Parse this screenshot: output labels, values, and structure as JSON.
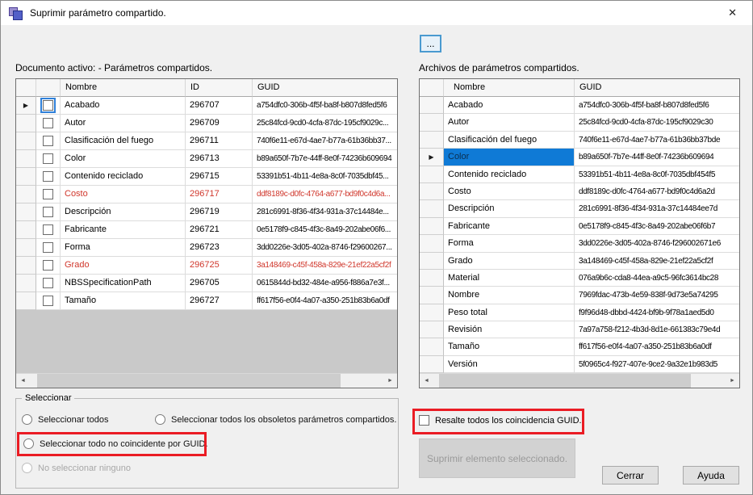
{
  "window": {
    "title": "Suprimir parámetro compartido.",
    "close_glyph": "✕"
  },
  "toolbar": {
    "browse_label": "..."
  },
  "icons": {
    "row_arrow": "▶",
    "scroll_left": "◄",
    "scroll_right": "►"
  },
  "colors": {
    "selection_bg": "#0f7ad6",
    "red_text": "#d0372c",
    "annotation": "#ea1c24",
    "focus_blue": "#2f80d9"
  },
  "left_panel": {
    "label": "Documento activo: - Parámetros compartidos.",
    "columns": [
      "Nombre",
      "ID",
      "GUID"
    ],
    "rows": [
      {
        "nombre": "Acabado",
        "id": "296707",
        "guid": "a754dfc0-306b-4f5f-ba8f-b807d8fed5f6",
        "red": false,
        "current": true,
        "checkbox_focused": true
      },
      {
        "nombre": "Autor",
        "id": "296709",
        "guid": "25c84fcd-9cd0-4cfa-87dc-195cf9029c...",
        "red": false,
        "current": false,
        "checkbox_focused": false
      },
      {
        "nombre": "Clasificación del fuego",
        "id": "296711",
        "guid": "740f6e11-e67d-4ae7-b77a-61b36bb37...",
        "red": false,
        "current": false,
        "checkbox_focused": false
      },
      {
        "nombre": "Color",
        "id": "296713",
        "guid": "b89a650f-7b7e-44ff-8e0f-74236b609694",
        "red": false,
        "current": false,
        "checkbox_focused": false
      },
      {
        "nombre": "Contenido reciclado",
        "id": "296715",
        "guid": "53391b51-4b11-4e8a-8c0f-7035dbf45...",
        "red": false,
        "current": false,
        "checkbox_focused": false
      },
      {
        "nombre": "Costo",
        "id": "296717",
        "guid": "ddf8189c-d0fc-4764-a677-bd9f0c4d6a...",
        "red": true,
        "current": false,
        "checkbox_focused": false
      },
      {
        "nombre": "Descripción",
        "id": "296719",
        "guid": "281c6991-8f36-4f34-931a-37c14484e...",
        "red": false,
        "current": false,
        "checkbox_focused": false
      },
      {
        "nombre": "Fabricante",
        "id": "296721",
        "guid": "0e5178f9-c845-4f3c-8a49-202abe06f6...",
        "red": false,
        "current": false,
        "checkbox_focused": false
      },
      {
        "nombre": "Forma",
        "id": "296723",
        "guid": "3dd0226e-3d05-402a-8746-f29600267...",
        "red": false,
        "current": false,
        "checkbox_focused": false
      },
      {
        "nombre": "Grado",
        "id": "296725",
        "guid": "3a148469-c45f-458a-829e-21ef22a5cf2f",
        "red": true,
        "current": false,
        "checkbox_focused": false
      },
      {
        "nombre": "NBSSpecificationPath",
        "id": "296705",
        "guid": "0615844d-bd32-484e-a956-f886a7e3f...",
        "red": false,
        "current": false,
        "checkbox_focused": false
      },
      {
        "nombre": "Tamaño",
        "id": "296727",
        "guid": "ff617f56-e0f4-4a07-a350-251b83b6a0df",
        "red": false,
        "current": false,
        "checkbox_focused": false
      }
    ]
  },
  "right_panel": {
    "label": "Archivos de parámetros compartidos.",
    "columns": [
      "Nombre",
      "GUID"
    ],
    "selected_index": 3,
    "rows": [
      {
        "nombre": "Acabado",
        "guid": "a754dfc0-306b-4f5f-ba8f-b807d8fed5f6"
      },
      {
        "nombre": "Autor",
        "guid": "25c84fcd-9cd0-4cfa-87dc-195cf9029c30"
      },
      {
        "nombre": "Clasificación del fuego",
        "guid": "740f6e11-e67d-4ae7-b77a-61b36bb37bde"
      },
      {
        "nombre": "Color",
        "guid": "b89a650f-7b7e-44ff-8e0f-74236b609694"
      },
      {
        "nombre": "Contenido reciclado",
        "guid": "53391b51-4b11-4e8a-8c0f-7035dbf454f5"
      },
      {
        "nombre": "Costo",
        "guid": "ddf8189c-d0fc-4764-a677-bd9f0c4d6a2d"
      },
      {
        "nombre": "Descripción",
        "guid": "281c6991-8f36-4f34-931a-37c14484ee7d"
      },
      {
        "nombre": "Fabricante",
        "guid": "0e5178f9-c845-4f3c-8a49-202abe06f6b7"
      },
      {
        "nombre": "Forma",
        "guid": "3dd0226e-3d05-402a-8746-f296002671e6"
      },
      {
        "nombre": "Grado",
        "guid": "3a148469-c45f-458a-829e-21ef22a5cf2f"
      },
      {
        "nombre": "Material",
        "guid": "076a9b6c-cda8-44ea-a9c5-96fc3614bc28"
      },
      {
        "nombre": "Nombre",
        "guid": "7969fdac-473b-4e59-838f-9d73e5a74295"
      },
      {
        "nombre": "Peso total",
        "guid": "f9f96d48-dbbd-4424-bf9b-9f78a1aed5d0"
      },
      {
        "nombre": "Revisión",
        "guid": "7a97a758-f212-4b3d-8d1e-661383c79e4d"
      },
      {
        "nombre": "Tamaño",
        "guid": "ff617f56-e0f4-4a07-a350-251b83b6a0df"
      },
      {
        "nombre": "Versión",
        "guid": "5f0965c4-f927-407e-9ce2-9a32e1b983d5"
      }
    ]
  },
  "select_group": {
    "title": "Seleccionar",
    "options": [
      {
        "label": "Seleccionar todos",
        "disabled": false,
        "highlighted": false
      },
      {
        "label": "Seleccionar todos los obsoletos parámetros compartidos.",
        "disabled": false,
        "highlighted": false
      },
      {
        "label": "Seleccionar todo no coincidente por GUID.",
        "disabled": false,
        "highlighted": true
      },
      {
        "label": "No seleccionar ninguno",
        "disabled": true,
        "highlighted": false
      }
    ]
  },
  "actions": {
    "highlight_checkbox_label": "Resalte todos los coincidencia GUID.",
    "delete_button_label": "Suprimir elemento seleccionado.",
    "close_button_label": "Cerrar",
    "help_button_label": "Ayuda"
  }
}
